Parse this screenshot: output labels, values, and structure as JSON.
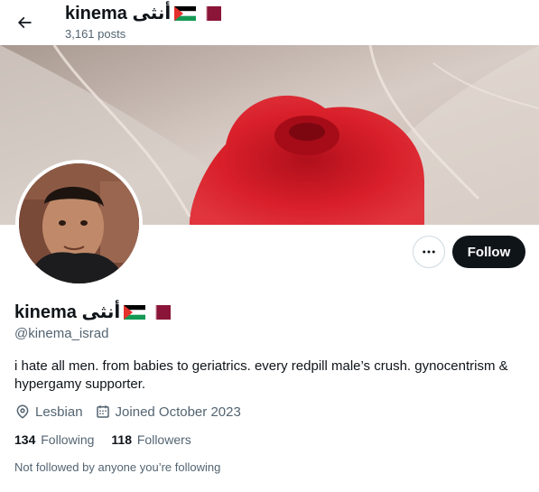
{
  "header": {
    "name": "kinema أنثى",
    "posts": "3,161 posts"
  },
  "profile": {
    "name": "kinema أنثى",
    "handle": "@kinema_israd",
    "bio": "i hate all men. from babies to geriatrics. every redpill male’s crush. gynocentrism & hypergamy supporter.",
    "location": "Lesbian",
    "joined": "Joined October 2023",
    "following_count": "134",
    "following_label": "Following",
    "followers_count": "118",
    "followers_label": "Followers",
    "not_followed_text": "Not followed by anyone you’re following"
  },
  "actions": {
    "follow_label": "Follow"
  },
  "icons": {
    "back": "arrow-left-icon",
    "more": "more-horizontal-icon",
    "location": "location-pin-icon",
    "calendar": "calendar-icon",
    "flag1": "palestine-flag-icon",
    "flag2": "qatar-flag-icon"
  },
  "colors": {
    "primary_text": "#0f1419",
    "secondary_text": "#536471",
    "button_dark": "#0f1419",
    "border": "#cfd9de"
  }
}
